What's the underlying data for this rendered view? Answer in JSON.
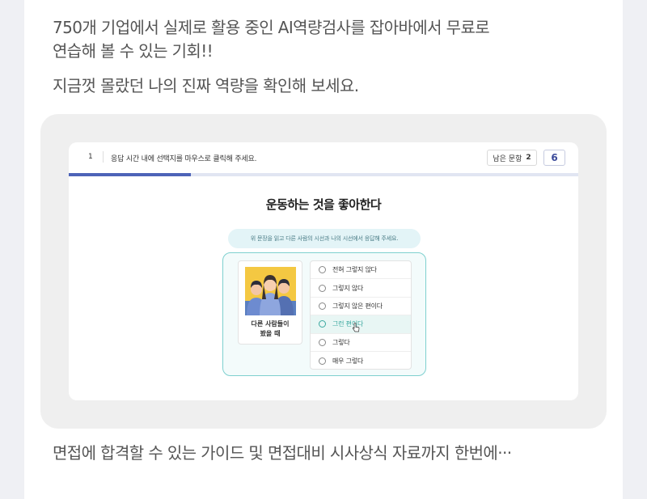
{
  "intro": {
    "line1": "750개 기업에서 실제로 활용 중인 AI역량검사를 잡아바에서 무료로",
    "line2": "연습해 볼 수 있는 기회!!",
    "line3": "지금껏 몰랐던 나의 진짜 역량을 확인해 보세요."
  },
  "test": {
    "question_number": "1",
    "instruction": "응답 시간 내에 선택지를 마우스로 클릭해 주세요.",
    "remaining_label": "남은 문항",
    "remaining_count": "2",
    "counter": "6",
    "progress_fraction": 0.24,
    "question_title": "운동하는 것을 좋아한다",
    "hint": "위 문장을 읽고 다른 사람의 시선과 나의 시선에서 응답해 주세요.",
    "scenario_label": "다른 사람들이\n봤을 때",
    "options": [
      "전혀 그렇지 않다",
      "그렇지 않다",
      "그렇지 않은 편이다",
      "그런 편이다",
      "그렇다",
      "매우 그렇다"
    ],
    "hovered_option_index": 3,
    "accent_color": "#4d63b8",
    "highlight_color": "#7ed0cf"
  },
  "footer": {
    "text": "면접에 합격할 수 있는 가이드 및 면접대비 시사상식 자료까지 한번에···"
  }
}
